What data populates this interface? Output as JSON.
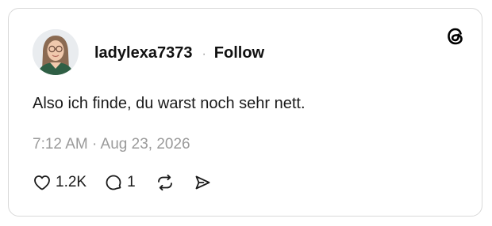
{
  "post": {
    "author": {
      "username": "ladylexa7373",
      "avatar_icon": "user-avatar-photo"
    },
    "separator": "·",
    "follow_label": "Follow",
    "brand_icon": "threads-logo-icon",
    "text": "Also ich finde, du warst noch sehr nett.",
    "timestamp": "7:12 AM · Aug 23, 2026",
    "actions": {
      "like": {
        "icon": "heart-icon",
        "count": "1.2K"
      },
      "reply": {
        "icon": "comment-icon",
        "count": "1"
      },
      "repost": {
        "icon": "repost-icon"
      },
      "share": {
        "icon": "send-icon"
      }
    }
  },
  "colors": {
    "text": "#1a1a1a",
    "muted": "#9a9a9a",
    "border": "#d8d8d8",
    "background": "#ffffff"
  }
}
